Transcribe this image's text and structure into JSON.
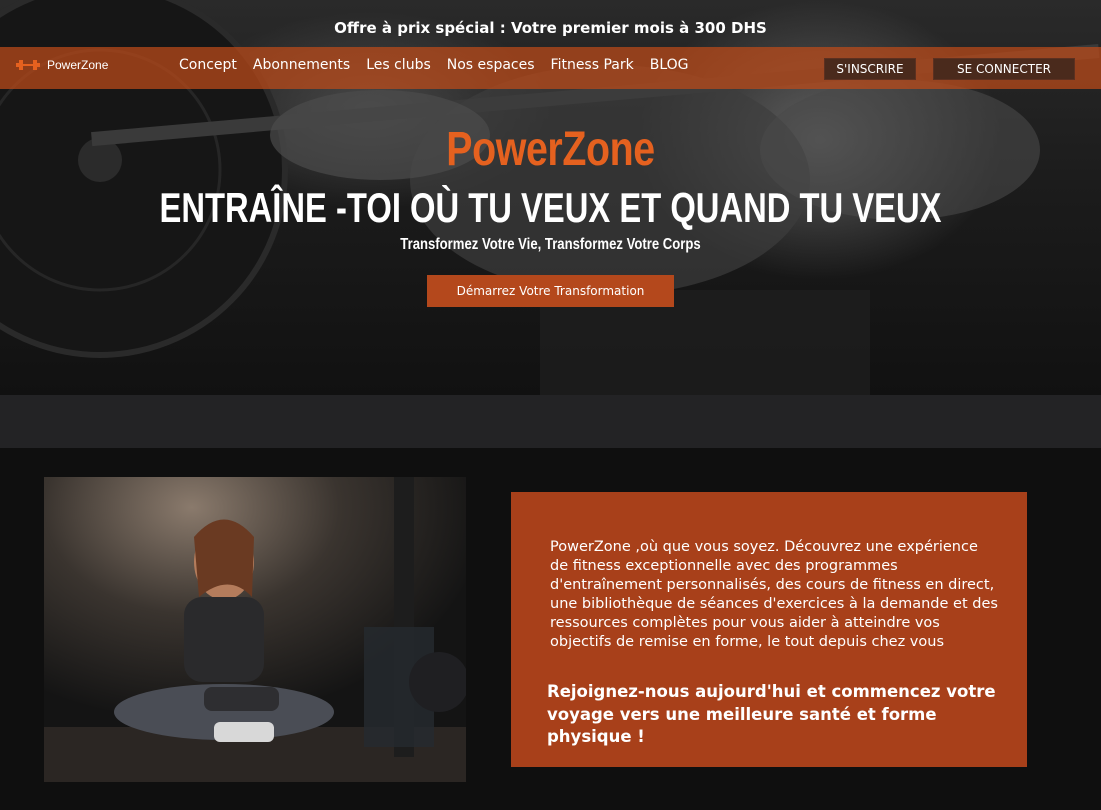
{
  "promo": {
    "text": "Offre à prix spécial : Votre premier mois à 300 DHS"
  },
  "navbar": {
    "brand": "PowerZone",
    "links": [
      "Concept",
      "Abonnements",
      "Les clubs",
      "Nos espaces",
      "Fitness Park",
      "BLOG"
    ],
    "signup_label": "S'INSCRIRE",
    "login_label": "SE CONNECTER"
  },
  "hero": {
    "brand": "PowerZone",
    "tagline": "ENTRAÎNE -TOI OÙ TU VEUX ET QUAND TU VEUX",
    "subtitle": "Transformez Votre Vie, Transformez Votre Corps",
    "cta_label": "Démarrez Votre Transformation"
  },
  "about": {
    "description": "PowerZone ,où que vous soyez. Découvrez une expérience de fitness exceptionnelle avec des programmes d'entraînement personnalisés, des cours de fitness en direct, une bibliothèque de séances d'exercices à la demande et des ressources complètes pour vous aider à atteindre vos objectifs de remise en forme, le tout depuis chez vous",
    "call_to_action": "Rejoignez-nous aujourd'hui et commencez votre voyage vers une meilleure santé et forme physique !"
  },
  "colors": {
    "accent": "#e5611f",
    "nav_bar": "#be4b19",
    "card": "#a8401a",
    "button_dark": "#4a2a1c",
    "background": "#0f0f0f",
    "band": "#232325"
  },
  "icons": {
    "brand_icon": "dumbbell-icon"
  }
}
